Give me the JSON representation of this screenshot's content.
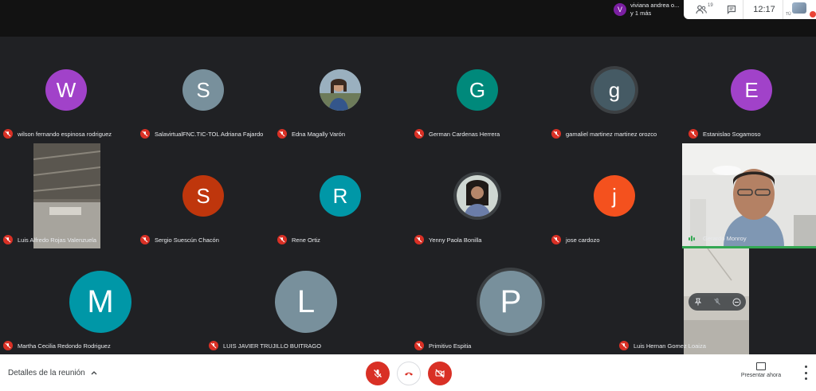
{
  "banner": {
    "initial": "V",
    "line1": "viviana andrea o...",
    "line2": "y 1 más"
  },
  "top_controls": {
    "people_count": "19",
    "clock": "12:17",
    "self_label": "TÚ"
  },
  "participants": [
    {
      "name": "wilson fernando espinosa rodriguez",
      "initial": "W",
      "color": "#a142c9"
    },
    {
      "name": "SalavirtualFNC.TIC-TOL Adriana Fajardo",
      "initial": "S",
      "color": "#78909c"
    },
    {
      "name": "Edna Magally Varón",
      "initial": "",
      "color": "#8aa"
    },
    {
      "name": "German Cardenas Herrera",
      "initial": "G",
      "color": "#00897b"
    },
    {
      "name": "gamaliel martinez martinez orozco",
      "initial": "g",
      "color": "#455a64"
    },
    {
      "name": "Estanislao Sogamoso",
      "initial": "E",
      "color": "#a142c9"
    },
    {
      "name": "Luis Alfredo Rojas Valenzuela",
      "initial": "",
      "color": ""
    },
    {
      "name": "Sergio Suescún Chacón",
      "initial": "S",
      "color": "#bf360c"
    },
    {
      "name": "Rene Ortiz",
      "initial": "R",
      "color": "#0097a7"
    },
    {
      "name": "Yenny Paola Bonilla",
      "initial": "",
      "color": ""
    },
    {
      "name": "jose cardozo",
      "initial": "j",
      "color": "#f4511e"
    },
    {
      "name": "Gerardo Monroy",
      "initial": "",
      "color": ""
    },
    {
      "name": "Martha Cecilia Redondo Rodriguez",
      "initial": "M",
      "color": "#0097a7"
    },
    {
      "name": "LUIS JAVIER TRUJILLO BUITRAGO",
      "initial": "L",
      "color": "#78909c"
    },
    {
      "name": "Primitivo Espitia",
      "initial": "P",
      "color": "#78909c"
    },
    {
      "name": "Luis Hernan Gomez Loaiza",
      "initial": "",
      "color": ""
    }
  ],
  "bottom": {
    "details_label": "Detalles de la reunión",
    "present_label": "Presentar ahora"
  },
  "colors": {
    "mute_red": "#d93025",
    "accent_green": "#34a853"
  }
}
